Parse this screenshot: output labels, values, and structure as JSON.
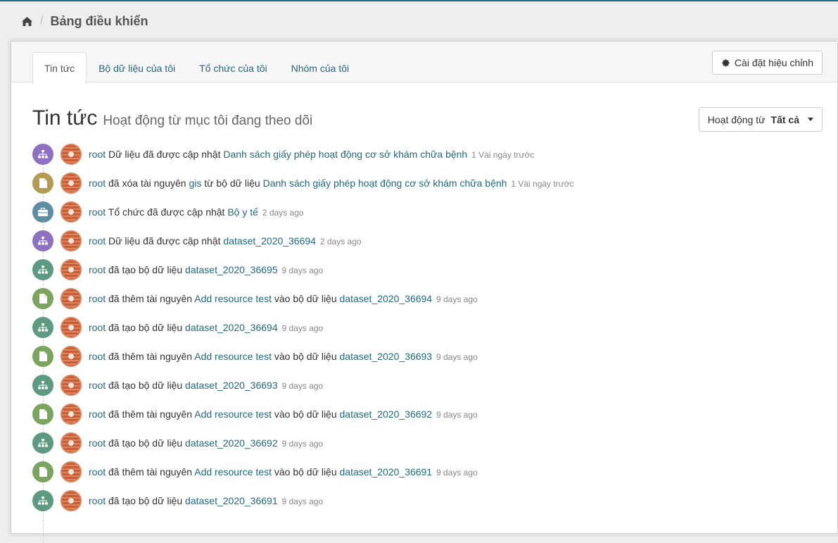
{
  "breadcrumb": {
    "title": "Bảng điều khiển"
  },
  "tabs": [
    {
      "label": "Tin tức",
      "active": true
    },
    {
      "label": "Bộ dữ liệu của tôi",
      "active": false
    },
    {
      "label": "Tổ chức của tôi",
      "active": false
    },
    {
      "label": "Nhóm của tôi",
      "active": false
    }
  ],
  "settings_button": {
    "label": "Cài đặt hiệu chỉnh",
    "icon": "gear-icon"
  },
  "heading": {
    "title": "Tin tức",
    "subtitle": "Hoạt động từ mục tôi đang theo dõi"
  },
  "filter": {
    "label": "Hoạt động từ",
    "value": "Tất cả"
  },
  "colors": {
    "link": "#206b82",
    "dataset_changed": "#8f71c4",
    "deleted_resource": "#b59a52",
    "org_changed": "#5d8ea5",
    "new_package": "#5d9a82",
    "new_resource": "#7aa55d"
  },
  "activities": [
    {
      "type": "dataset_changed",
      "icon": "sitemap-icon",
      "user": "root",
      "parts": [
        "Dữ liệu đã được cập nhật"
      ],
      "links": [
        "Danh sách giấy phép hoạt động cơ sở khám chữa bệnh"
      ],
      "time": "1 Vài ngày trước"
    },
    {
      "type": "deleted_resource",
      "icon": "file-icon",
      "user": "root",
      "parts": [
        "đã xóa tài nguyên",
        "từ bộ dữ liệu"
      ],
      "links": [
        "gis",
        "Danh sách giấy phép hoạt động cơ sở khám chữa bệnh"
      ],
      "time": "1 Vài ngày trước"
    },
    {
      "type": "org_changed",
      "icon": "briefcase-icon",
      "user": "root",
      "parts": [
        "Tổ chức đã được cập nhật"
      ],
      "links": [
        "Bộ y tế"
      ],
      "time": "2 days ago"
    },
    {
      "type": "dataset_changed",
      "icon": "sitemap-icon",
      "user": "root",
      "parts": [
        "Dữ liệu đã được cập nhật"
      ],
      "links": [
        "dataset_2020_36694"
      ],
      "time": "2 days ago"
    },
    {
      "type": "new_package",
      "icon": "sitemap-icon",
      "user": "root",
      "parts": [
        "đã tạo bộ dữ liệu"
      ],
      "links": [
        "dataset_2020_36695"
      ],
      "time": "9 days ago"
    },
    {
      "type": "new_resource",
      "icon": "file-icon",
      "user": "root",
      "parts": [
        "đã thêm tài nguyên",
        "vào bộ dữ liệu"
      ],
      "links": [
        "Add resource test",
        "dataset_2020_36694"
      ],
      "time": "9 days ago"
    },
    {
      "type": "new_package",
      "icon": "sitemap-icon",
      "user": "root",
      "parts": [
        "đã tạo bộ dữ liệu"
      ],
      "links": [
        "dataset_2020_36694"
      ],
      "time": "9 days ago"
    },
    {
      "type": "new_resource",
      "icon": "file-icon",
      "user": "root",
      "parts": [
        "đã thêm tài nguyên",
        "vào bộ dữ liệu"
      ],
      "links": [
        "Add resource test",
        "dataset_2020_36693"
      ],
      "time": "9 days ago"
    },
    {
      "type": "new_package",
      "icon": "sitemap-icon",
      "user": "root",
      "parts": [
        "đã tạo bộ dữ liệu"
      ],
      "links": [
        "dataset_2020_36693"
      ],
      "time": "9 days ago"
    },
    {
      "type": "new_resource",
      "icon": "file-icon",
      "user": "root",
      "parts": [
        "đã thêm tài nguyên",
        "vào bộ dữ liệu"
      ],
      "links": [
        "Add resource test",
        "dataset_2020_36692"
      ],
      "time": "9 days ago"
    },
    {
      "type": "new_package",
      "icon": "sitemap-icon",
      "user": "root",
      "parts": [
        "đã tạo bộ dữ liệu"
      ],
      "links": [
        "dataset_2020_36692"
      ],
      "time": "9 days ago"
    },
    {
      "type": "new_resource",
      "icon": "file-icon",
      "user": "root",
      "parts": [
        "đã thêm tài nguyên",
        "vào bộ dữ liệu"
      ],
      "links": [
        "Add resource test",
        "dataset_2020_36691"
      ],
      "time": "9 days ago"
    },
    {
      "type": "new_package",
      "icon": "sitemap-icon",
      "user": "root",
      "parts": [
        "đã tạo bộ dữ liệu"
      ],
      "links": [
        "dataset_2020_36691"
      ],
      "time": "9 days ago"
    }
  ]
}
